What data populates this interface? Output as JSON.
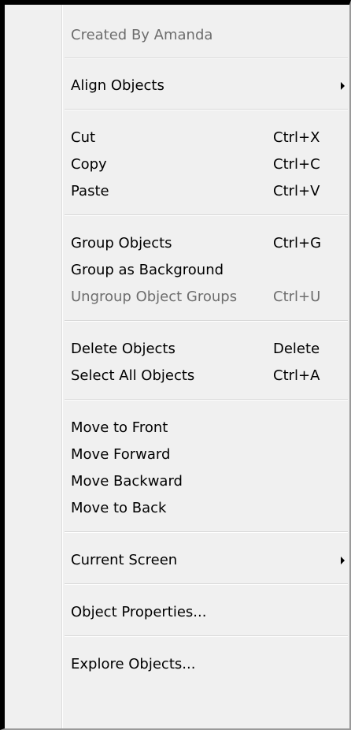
{
  "menu": {
    "header": "Created By Amanda",
    "align_objects": "Align Objects",
    "cut": {
      "label": "Cut",
      "shortcut": "Ctrl+X"
    },
    "copy": {
      "label": "Copy",
      "shortcut": "Ctrl+C"
    },
    "paste": {
      "label": "Paste",
      "shortcut": "Ctrl+V"
    },
    "group_objects": {
      "label": "Group Objects",
      "shortcut": "Ctrl+G"
    },
    "group_as_background": {
      "label": "Group as Background"
    },
    "ungroup_object_groups": {
      "label": "Ungroup Object Groups",
      "shortcut": "Ctrl+U"
    },
    "delete_objects": {
      "label": "Delete Objects",
      "shortcut": "Delete"
    },
    "select_all_objects": {
      "label": "Select All Objects",
      "shortcut": "Ctrl+A"
    },
    "move_to_front": "Move to Front",
    "move_forward": "Move Forward",
    "move_backward": "Move Backward",
    "move_to_back": "Move to Back",
    "current_screen": "Current Screen",
    "object_properties": "Object Properties...",
    "explore_objects": "Explore Objects..."
  },
  "icons": {
    "submenu_arrow": "chevron-right-icon"
  }
}
